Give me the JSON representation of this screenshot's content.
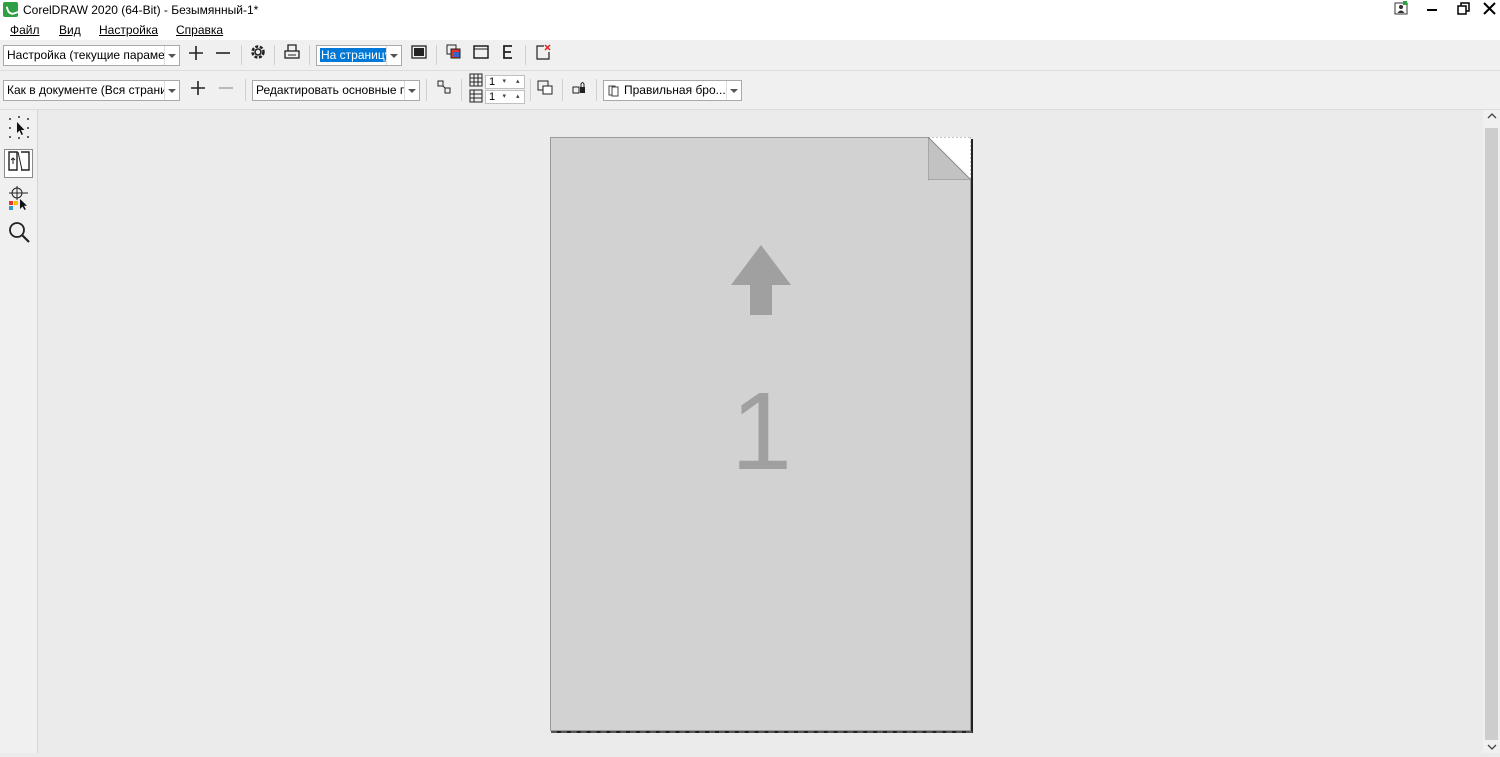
{
  "window": {
    "title": "CorelDRAW 2020 (64-Bit) - Безымянный-1*",
    "controls": {
      "user": "⍰",
      "minimize": "—",
      "restore": "❐",
      "close": "✕"
    }
  },
  "menu": [
    {
      "label": "Файл"
    },
    {
      "label": "Вид"
    },
    {
      "label": "Настройка"
    },
    {
      "label": "Справка"
    }
  ],
  "toolbar1": {
    "preset": "Настройка (текущие параме...",
    "zoom": "На страницу"
  },
  "toolbar2": {
    "print_range": "Как в документе (Вся страни...",
    "layout": "Редактировать основные п...",
    "rows": "1",
    "cols": "1",
    "imposition": "Правильная бро..."
  },
  "canvas": {
    "page_number": "1"
  },
  "colors": {
    "page": "#d2d2d2",
    "selection": "#0078d7",
    "logo": "#2ea043"
  }
}
